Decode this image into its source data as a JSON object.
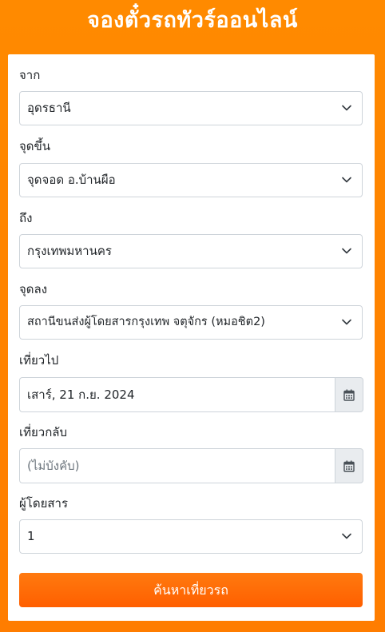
{
  "header": {
    "title": "จองตั๋วรถทัวร์ออนไลน์"
  },
  "form": {
    "from": {
      "label": "จาก",
      "value": "อุดรธานี"
    },
    "pickup": {
      "label": "จุดขึ้น",
      "value": "จุดจอด อ.บ้านผือ"
    },
    "to": {
      "label": "ถึง",
      "value": "กรุงเทพมหานคร"
    },
    "dropoff": {
      "label": "จุดลง",
      "value": "สถานีขนส่งผู้โดยสารกรุงเทพ จตุจักร (หมอชิต2)"
    },
    "depart": {
      "label": "เที่ยวไป",
      "value": "เสาร์, 21 ก.ย. 2024"
    },
    "return": {
      "label": "เที่ยวกลับ",
      "value": "",
      "placeholder": "(ไม่บังคับ)"
    },
    "passengers": {
      "label": "ผู้โดยสาร",
      "value": "1"
    },
    "search_button": "ค้นหาเที่ยวรถ"
  },
  "colors": {
    "background": "#ff8a00",
    "button": "#ff6a00",
    "addon": "#e9ecef",
    "border": "#ced4da"
  },
  "icons": {
    "select_arrow": "chevron-down-icon",
    "date_picker": "calendar-icon"
  }
}
